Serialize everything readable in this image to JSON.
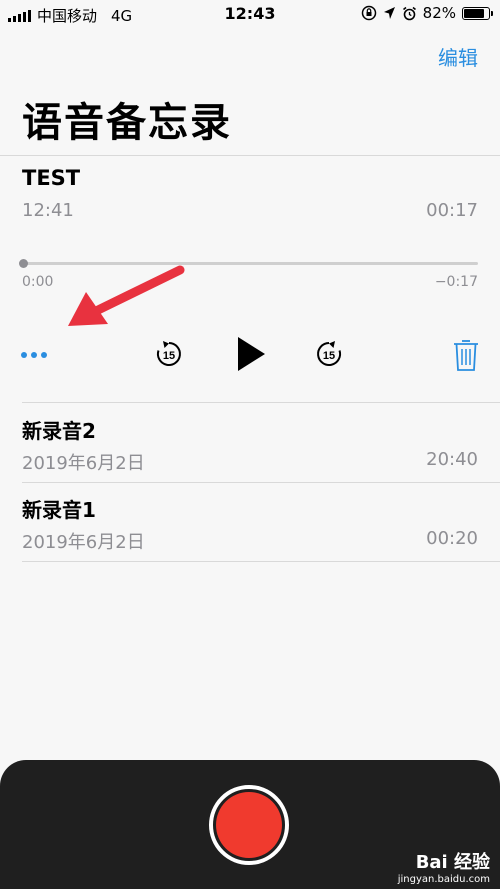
{
  "status": {
    "carrier": "中国移动",
    "network": "4G",
    "time": "12:43",
    "battery": "82%",
    "battery_level": 0.82
  },
  "header": {
    "edit_label": "编辑",
    "title": "语音备忘录"
  },
  "expanded": {
    "title": "TEST",
    "time": "12:41",
    "duration": "00:17",
    "elapsed": "0:00",
    "remaining": "−0:17",
    "progress": 0,
    "skip_back_label": "15",
    "skip_forward_label": "15"
  },
  "recordings": [
    {
      "title": "新录音2",
      "date": "2019年6月2日",
      "duration": "20:40"
    },
    {
      "title": "新录音1",
      "date": "2019年6月2日",
      "duration": "00:20"
    }
  ],
  "colors": {
    "accent": "#2a8ee0",
    "record": "#f03a2e",
    "annotation_arrow": "#e8323f"
  },
  "watermark": {
    "brand": "Bai 经验",
    "url": "jingyan.baidu.com"
  }
}
